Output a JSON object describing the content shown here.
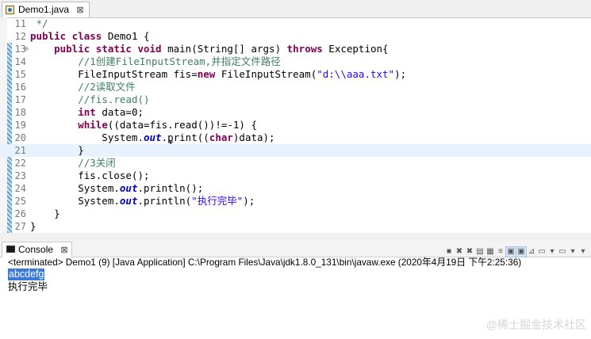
{
  "editor": {
    "tab_title": "Demo1.java",
    "tab_close": "⊠",
    "lines": [
      {
        "num": "11",
        "fold": "",
        "tokens": [
          {
            "t": "cm",
            "v": " */"
          }
        ]
      },
      {
        "num": "12",
        "fold": "",
        "tokens": [
          {
            "t": "kw",
            "v": "public class"
          },
          {
            "t": "",
            "v": " Demo1 {"
          }
        ]
      },
      {
        "num": "13",
        "fold": "⊖",
        "tokens": [
          {
            "t": "",
            "v": "    "
          },
          {
            "t": "kw",
            "v": "public static void"
          },
          {
            "t": "",
            "v": " main(String[] args) "
          },
          {
            "t": "kw",
            "v": "throws"
          },
          {
            "t": "",
            "v": " Exception{"
          }
        ]
      },
      {
        "num": "14",
        "fold": "",
        "tokens": [
          {
            "t": "",
            "v": "        "
          },
          {
            "t": "cm",
            "v": "//1创建FileInputStream,并指定文件路径"
          }
        ]
      },
      {
        "num": "15",
        "fold": "",
        "tokens": [
          {
            "t": "",
            "v": "        FileInputStream fis="
          },
          {
            "t": "kw",
            "v": "new"
          },
          {
            "t": "",
            "v": " FileInputStream("
          },
          {
            "t": "str",
            "v": "\"d:\\\\aaa.txt\""
          },
          {
            "t": "",
            "v": ");"
          }
        ]
      },
      {
        "num": "16",
        "fold": "",
        "tokens": [
          {
            "t": "",
            "v": "        "
          },
          {
            "t": "cm",
            "v": "//2读取文件"
          }
        ]
      },
      {
        "num": "17",
        "fold": "",
        "tokens": [
          {
            "t": "",
            "v": "        "
          },
          {
            "t": "cm",
            "v": "//fis.read()"
          }
        ]
      },
      {
        "num": "18",
        "fold": "",
        "tokens": [
          {
            "t": "",
            "v": "        "
          },
          {
            "t": "kw",
            "v": "int"
          },
          {
            "t": "",
            "v": " data=0;"
          }
        ]
      },
      {
        "num": "19",
        "fold": "",
        "tokens": [
          {
            "t": "",
            "v": "        "
          },
          {
            "t": "kw",
            "v": "while"
          },
          {
            "t": "",
            "v": "((data=fis.read())!=-1) {"
          }
        ]
      },
      {
        "num": "20",
        "fold": "",
        "tokens": [
          {
            "t": "",
            "v": "            System."
          },
          {
            "t": "fld",
            "v": "out"
          },
          {
            "t": "",
            "v": ".print(("
          },
          {
            "t": "kw",
            "v": "char"
          },
          {
            "t": "",
            "v": ")data);"
          }
        ]
      },
      {
        "num": "21",
        "fold": "",
        "current": true,
        "tokens": [
          {
            "t": "",
            "v": "        }"
          }
        ]
      },
      {
        "num": "22",
        "fold": "",
        "tokens": [
          {
            "t": "",
            "v": "        "
          },
          {
            "t": "cm",
            "v": "//3关闭"
          }
        ]
      },
      {
        "num": "23",
        "fold": "",
        "tokens": [
          {
            "t": "",
            "v": "        fis.close();"
          }
        ]
      },
      {
        "num": "24",
        "fold": "",
        "tokens": [
          {
            "t": "",
            "v": "        System."
          },
          {
            "t": "fld",
            "v": "out"
          },
          {
            "t": "",
            "v": ".println();"
          }
        ]
      },
      {
        "num": "25",
        "fold": "",
        "tokens": [
          {
            "t": "",
            "v": "        System."
          },
          {
            "t": "fld",
            "v": "out"
          },
          {
            "t": "",
            "v": ".println("
          },
          {
            "t": "str",
            "v": "\"执行完毕\""
          },
          {
            "t": "",
            "v": ");"
          }
        ]
      },
      {
        "num": "26",
        "fold": "",
        "tokens": [
          {
            "t": "",
            "v": "    }"
          }
        ]
      },
      {
        "num": "27",
        "fold": "",
        "tokens": [
          {
            "t": "",
            "v": "}"
          }
        ]
      }
    ]
  },
  "console": {
    "tab_title": "Console",
    "tab_close": "⊠",
    "toolbar_icons": [
      {
        "name": "terminate-icon",
        "glyph": "■"
      },
      {
        "name": "remove-launch-icon",
        "glyph": "✖"
      },
      {
        "name": "remove-all-launches-icon",
        "glyph": "✖"
      },
      {
        "name": "clear-console-icon",
        "glyph": "▤"
      },
      {
        "name": "scroll-lock-icon",
        "glyph": "▦"
      },
      {
        "name": "word-wrap-icon",
        "glyph": "≡"
      },
      {
        "name": "show-on-stdout-icon",
        "glyph": "▣"
      },
      {
        "name": "show-on-stderr-icon",
        "glyph": "▣"
      },
      {
        "name": "pin-console-icon",
        "glyph": "⊿"
      },
      {
        "name": "display-console-icon",
        "glyph": "▭"
      },
      {
        "name": "display-console-dropdown-icon",
        "glyph": "▾"
      },
      {
        "name": "open-console-icon",
        "glyph": "▭"
      },
      {
        "name": "open-console-dropdown-icon",
        "glyph": "▾"
      },
      {
        "name": "view-menu-icon",
        "glyph": "▾"
      }
    ],
    "terminated_line": "<terminated> Demo1 (9) [Java Application] C:\\Program Files\\Java\\jdk1.8.0_131\\bin\\javaw.exe (2020年4月19日 下午2:25:36)",
    "output": [
      {
        "text": "abcdefg",
        "selected": true
      },
      {
        "text": "执行完毕",
        "selected": false
      }
    ]
  },
  "watermark": "@稀土掘金技术社区"
}
